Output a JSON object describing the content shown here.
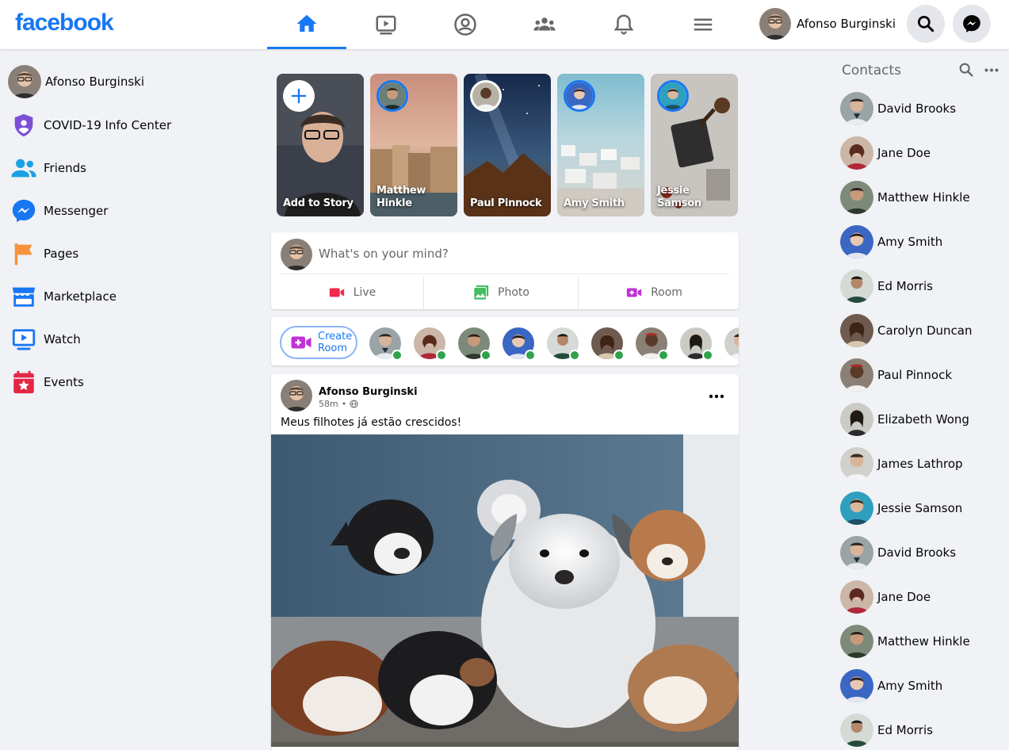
{
  "header": {
    "logo": "facebook",
    "profile_name": "Afonso Burginski",
    "accent": "#1877f2"
  },
  "nav_tabs": [
    {
      "icon": "home-icon",
      "active": true
    },
    {
      "icon": "watch-icon",
      "active": false
    },
    {
      "icon": "profile-icon",
      "active": false
    },
    {
      "icon": "groups-icon",
      "active": false
    },
    {
      "icon": "bell-icon",
      "active": false
    },
    {
      "icon": "menu-icon",
      "active": false
    }
  ],
  "sidebar": {
    "items": [
      {
        "label": "Afonso Burginski",
        "icon": "avatar"
      },
      {
        "label": "COVID-19 Info Center",
        "icon": "shield-icon"
      },
      {
        "label": "Friends",
        "icon": "friends-icon"
      },
      {
        "label": "Messenger",
        "icon": "messenger-icon"
      },
      {
        "label": "Pages",
        "icon": "flag-icon"
      },
      {
        "label": "Marketplace",
        "icon": "store-icon"
      },
      {
        "label": "Watch",
        "icon": "watch-icon"
      },
      {
        "label": "Events",
        "icon": "calendar-icon"
      }
    ]
  },
  "stories": [
    {
      "name": "Add to Story"
    },
    {
      "name": "Matthew Hinkle"
    },
    {
      "name": "Paul Pinnock"
    },
    {
      "name": "Amy Smith"
    },
    {
      "name": "Jessie Samson"
    }
  ],
  "composer": {
    "placeholder": "What's on your mind?",
    "actions": [
      {
        "label": "Live",
        "icon": "video-camera-icon",
        "color": "#f02849"
      },
      {
        "label": "Photo",
        "icon": "photo-icon",
        "color": "#45bd62"
      },
      {
        "label": "Room",
        "icon": "room-icon",
        "color": "#a033ff"
      }
    ]
  },
  "rooms": {
    "create_label_1": "Create",
    "create_label_2": "Room"
  },
  "post": {
    "author": "Afonso Burginski",
    "time": "58m",
    "separator": "•",
    "text": "Meus filhotes já estão crescidos!"
  },
  "contacts": {
    "title": "Contacts",
    "list": [
      "David Brooks",
      "Jane Doe",
      "Matthew Hinkle",
      "Amy Smith",
      "Ed Morris",
      "Carolyn Duncan",
      "Paul Pinnock",
      "Elizabeth Wong",
      "James Lathrop",
      "Jessie Samson",
      "David Brooks",
      "Jane Doe",
      "Matthew Hinkle",
      "Amy Smith",
      "Ed Morris"
    ]
  }
}
